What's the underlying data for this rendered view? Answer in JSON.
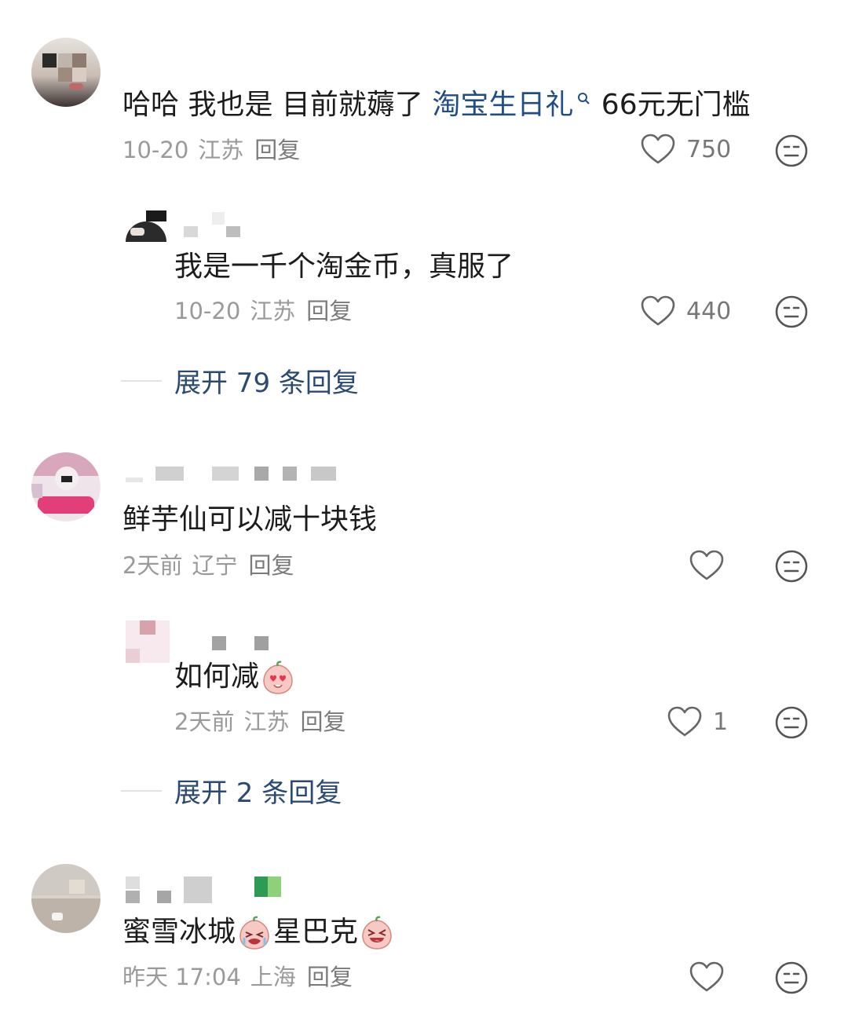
{
  "threads": [
    {
      "comment": {
        "text_prefix": "哈哈 我也是 目前就薅了 ",
        "link_text": "淘宝生日礼",
        "text_suffix": " 66元无门槛",
        "date": "10-20",
        "location": "江苏",
        "reply_label": "回复",
        "likes": "750"
      },
      "reply": {
        "text": "我是一千个淘金币，真服了",
        "date": "10-20",
        "location": "江苏",
        "reply_label": "回复",
        "likes": "440"
      },
      "expand_label": "展开 79 条回复"
    },
    {
      "comment": {
        "text": "鲜芋仙可以减十块钱",
        "date": "2天前",
        "location": "辽宁",
        "reply_label": "回复",
        "likes": ""
      },
      "reply": {
        "text": "如何减",
        "sticker": "heart-eyes-peach-sticker",
        "date": "2天前",
        "location": "江苏",
        "reply_label": "回复",
        "likes": "1"
      },
      "expand_label": "展开 2 条回复"
    },
    {
      "comment": {
        "text_a": "蜜雪冰城",
        "text_b": "星巴克",
        "sticker_a": "crying-peach-sticker",
        "sticker_b": "laughing-peach-sticker",
        "date": "昨天 17:04",
        "location": "上海",
        "reply_label": "回复",
        "likes": ""
      }
    }
  ],
  "colors": {
    "link": "#1f4e86",
    "expand": "#2b4a73",
    "meta": "#9a9a9a"
  }
}
